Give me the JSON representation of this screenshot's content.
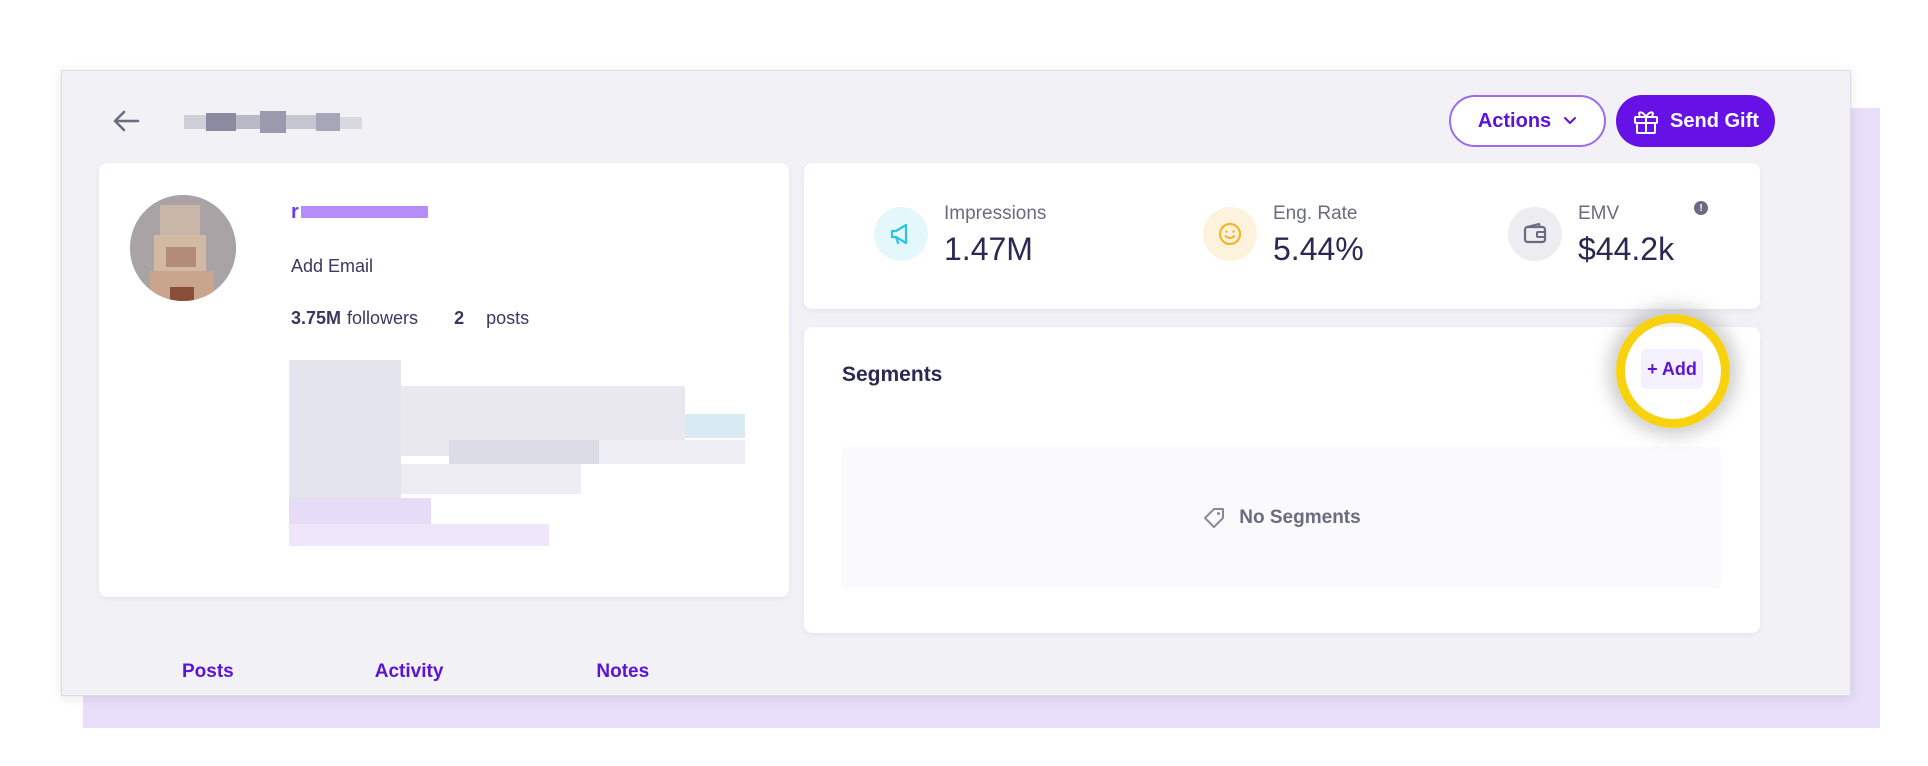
{
  "header": {
    "back_icon": "arrow-left-icon",
    "actions_label": "Actions",
    "send_gift_label": "Send Gift",
    "accent_color": "#6611e6"
  },
  "profile": {
    "add_email_label": "Add Email",
    "followers_count": "3.75M",
    "followers_label": "followers",
    "posts_count": "2",
    "posts_label": "posts"
  },
  "metrics": [
    {
      "label": "Impressions",
      "value": "1.47M",
      "icon": "megaphone-icon",
      "color": "#2cc4e0"
    },
    {
      "label": "Eng. Rate",
      "value": "5.44%",
      "icon": "smiley-icon",
      "color": "#f3b52c"
    },
    {
      "label": "EMV",
      "value": "$44.2k",
      "icon": "wallet-icon",
      "color": "#6b6b80"
    }
  ],
  "segments": {
    "title": "Segments",
    "add_label": "+ Add",
    "empty_label": "No Segments"
  },
  "tabs": [
    {
      "label": "Posts"
    },
    {
      "label": "Activity"
    },
    {
      "label": "Notes"
    }
  ]
}
